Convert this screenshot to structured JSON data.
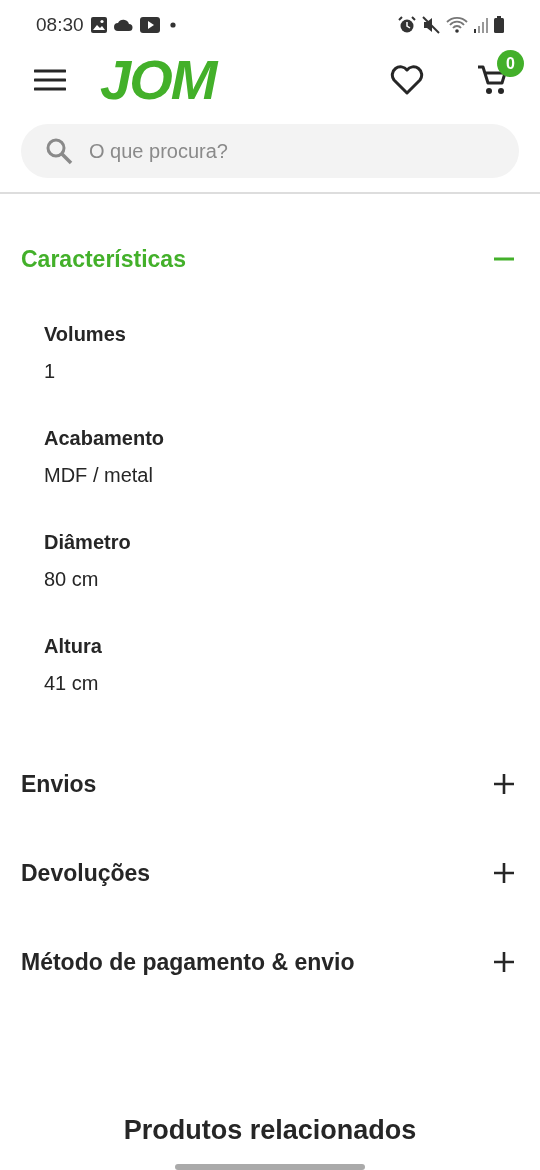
{
  "status_bar": {
    "time": "08:30"
  },
  "header": {
    "logo": "JOM",
    "cart_count": "0"
  },
  "search": {
    "placeholder": "O que procura?"
  },
  "sections": [
    {
      "title": "Características",
      "expanded": true,
      "properties": [
        {
          "label": "Volumes",
          "value": "1"
        },
        {
          "label": "Acabamento",
          "value": "MDF / metal"
        },
        {
          "label": "Diâmetro",
          "value": "80 cm"
        },
        {
          "label": "Altura",
          "value": "41 cm"
        }
      ]
    },
    {
      "title": "Envios",
      "expanded": false
    },
    {
      "title": "Devoluções",
      "expanded": false
    },
    {
      "title": "Método de pagamento & envio",
      "expanded": false
    }
  ],
  "related": {
    "title": "Produtos relacionados"
  }
}
